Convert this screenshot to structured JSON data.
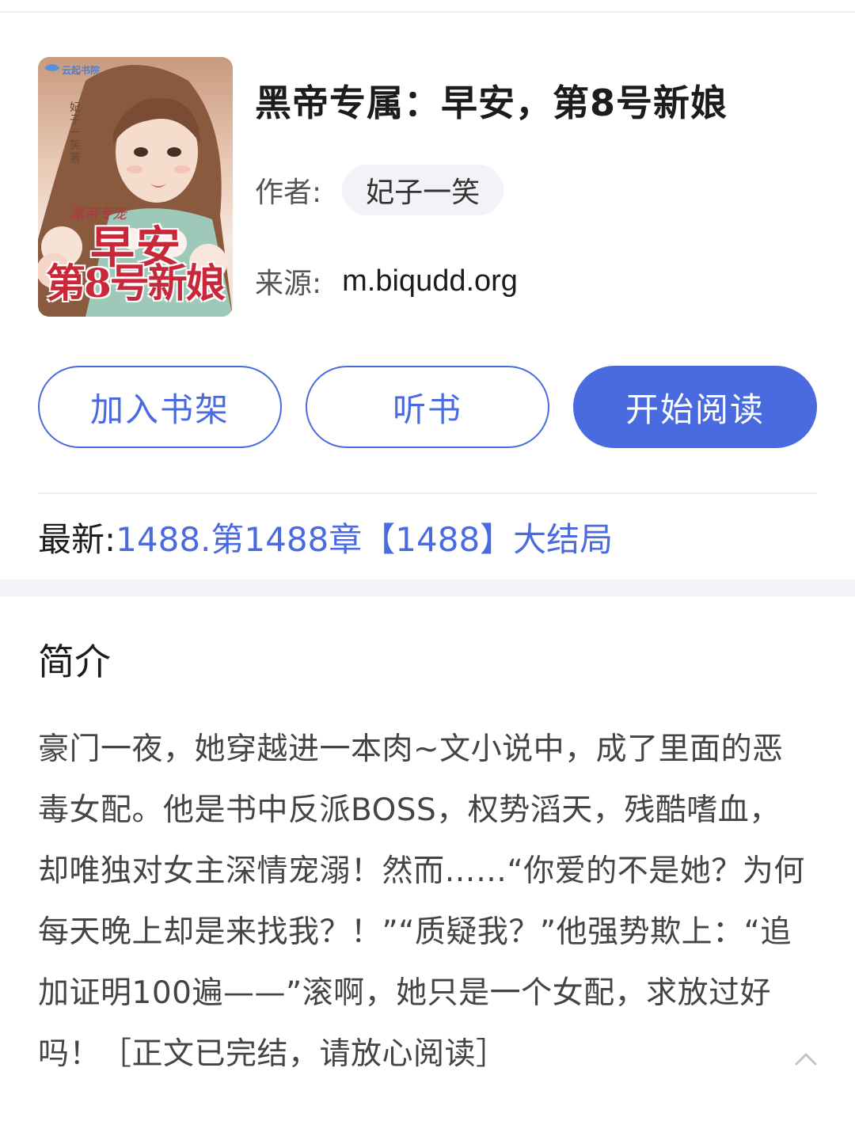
{
  "book": {
    "title": "黑帝专属：早安，第8号新娘",
    "author_label": "作者:",
    "author": "妃子一笑",
    "source_label": "来源:",
    "source": "m.biqudd.org"
  },
  "cover": {
    "publisher": "云起书院",
    "series": "黑帝专宠",
    "title_line1": "早安",
    "title_line2": "第8号新娘",
    "author_text": "妃子一笑著"
  },
  "actions": {
    "add_shelf": "加入书架",
    "listen": "听书",
    "start_read": "开始阅读"
  },
  "latest": {
    "label": "最新:",
    "chapter": "1488.第1488章【1488】大结局"
  },
  "intro": {
    "heading": "简介",
    "text": "豪门一夜，她穿越进一本肉~文小说中，成了里面的恶毒女配。他是书中反派BOSS，权势滔天，残酷嗜血，却唯独对女主深情宠溺！然而……“你爱的不是她？为何每天晚上却是来找我？！”“质疑我？”他强势欺上：“追加证明100遍——”滚啊，她只是一个女配，求放过好吗！［正文已完结，请放心阅读］"
  },
  "colors": {
    "accent": "#4a6be0",
    "chip_bg": "#f2f3f6",
    "section_gap": "#f4f5f8"
  },
  "icons": {
    "collapse": "chevron-up-icon"
  }
}
